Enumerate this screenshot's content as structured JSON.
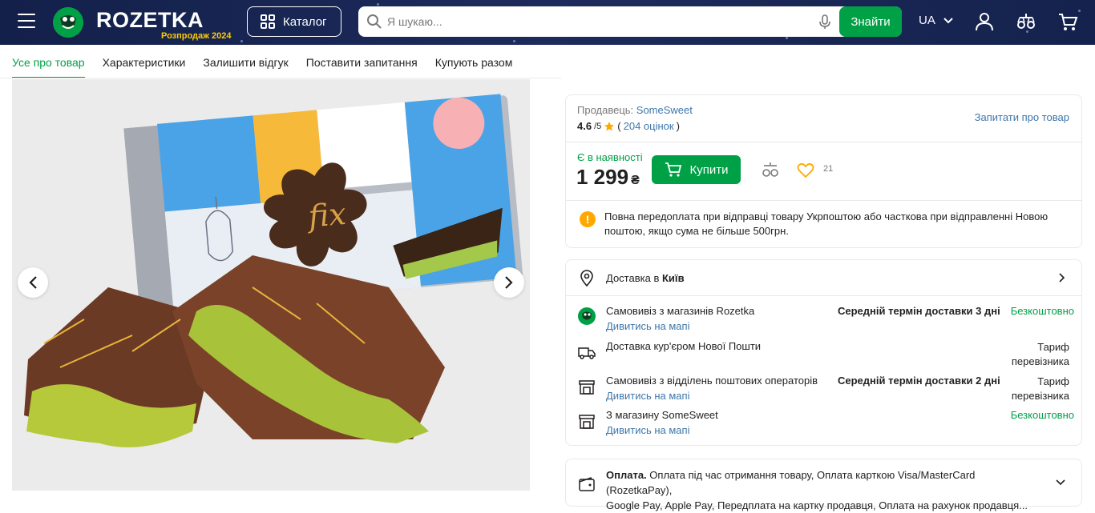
{
  "header": {
    "logo_text": "ROZETKA",
    "sale_label": "Розпродаж 2024",
    "catalog_label": "Каталог",
    "search_placeholder": "Я шукаю...",
    "search_button": "Знайти",
    "language": "UA"
  },
  "tabs": [
    {
      "label": "Усе про товар",
      "active": true
    },
    {
      "label": "Характеристики",
      "active": false
    },
    {
      "label": "Залишити відгук",
      "active": false
    },
    {
      "label": "Поставити запитання",
      "active": false
    },
    {
      "label": "Купують разом",
      "active": false
    }
  ],
  "product_image": {
    "brand_text": "fix",
    "icons": {
      "prev": "chevron-left-icon",
      "next": "chevron-right-icon"
    }
  },
  "seller": {
    "label": "Продавець:",
    "name": "SomeSweet",
    "rating": "4.6",
    "rating_max": "/5",
    "reviews_link": "204 оцінок",
    "ask_link": "Запитати про товар"
  },
  "offer": {
    "availability": "Є в наявності",
    "price": "1 299",
    "currency": "₴",
    "buy_label": "Купити",
    "favorites_count": "21"
  },
  "notice": {
    "text": "Повна передоплата при відправці товару Укрпоштою або часткова при відправленні Новою поштою, якщо сума не більше 500грн."
  },
  "delivery": {
    "title_prefix": "Доставка в",
    "city": "Київ",
    "options": [
      {
        "title": "Самовивіз з магазинів Rozetka",
        "link": "Дивитись на мапі",
        "term": "Середній термін доставки 3 дні",
        "price": "Безкоштовно",
        "price_green": true
      },
      {
        "title": "Доставка кур'єром Нової Пошти",
        "link": "",
        "term": "",
        "price_line1": "Тариф",
        "price_line2": "перевізника"
      },
      {
        "title": "Самовивіз з відділень поштових операторів",
        "link": "Дивитись на мапі",
        "term": "Середній термін доставки 2 дні",
        "price_line1": "Тариф",
        "price_line2": "перевізника"
      },
      {
        "title": "З магазину SomeSweet",
        "link": "Дивитись на мапі",
        "term": "",
        "price": "Безкоштовно",
        "price_green": true
      }
    ]
  },
  "payment": {
    "label": "Оплата.",
    "line1": "Оплата під час отримання товару, Оплата карткою Visa/MasterCard (RozetkaPay),",
    "line2": "Google Pay, Apple Pay, Передплата на картку продавця, Оплата на рахунок продавця..."
  },
  "colors": {
    "header_bg": "#1b2a56",
    "accent_green": "#00a046",
    "link_blue": "#3e77aa",
    "star": "#ffa900"
  }
}
